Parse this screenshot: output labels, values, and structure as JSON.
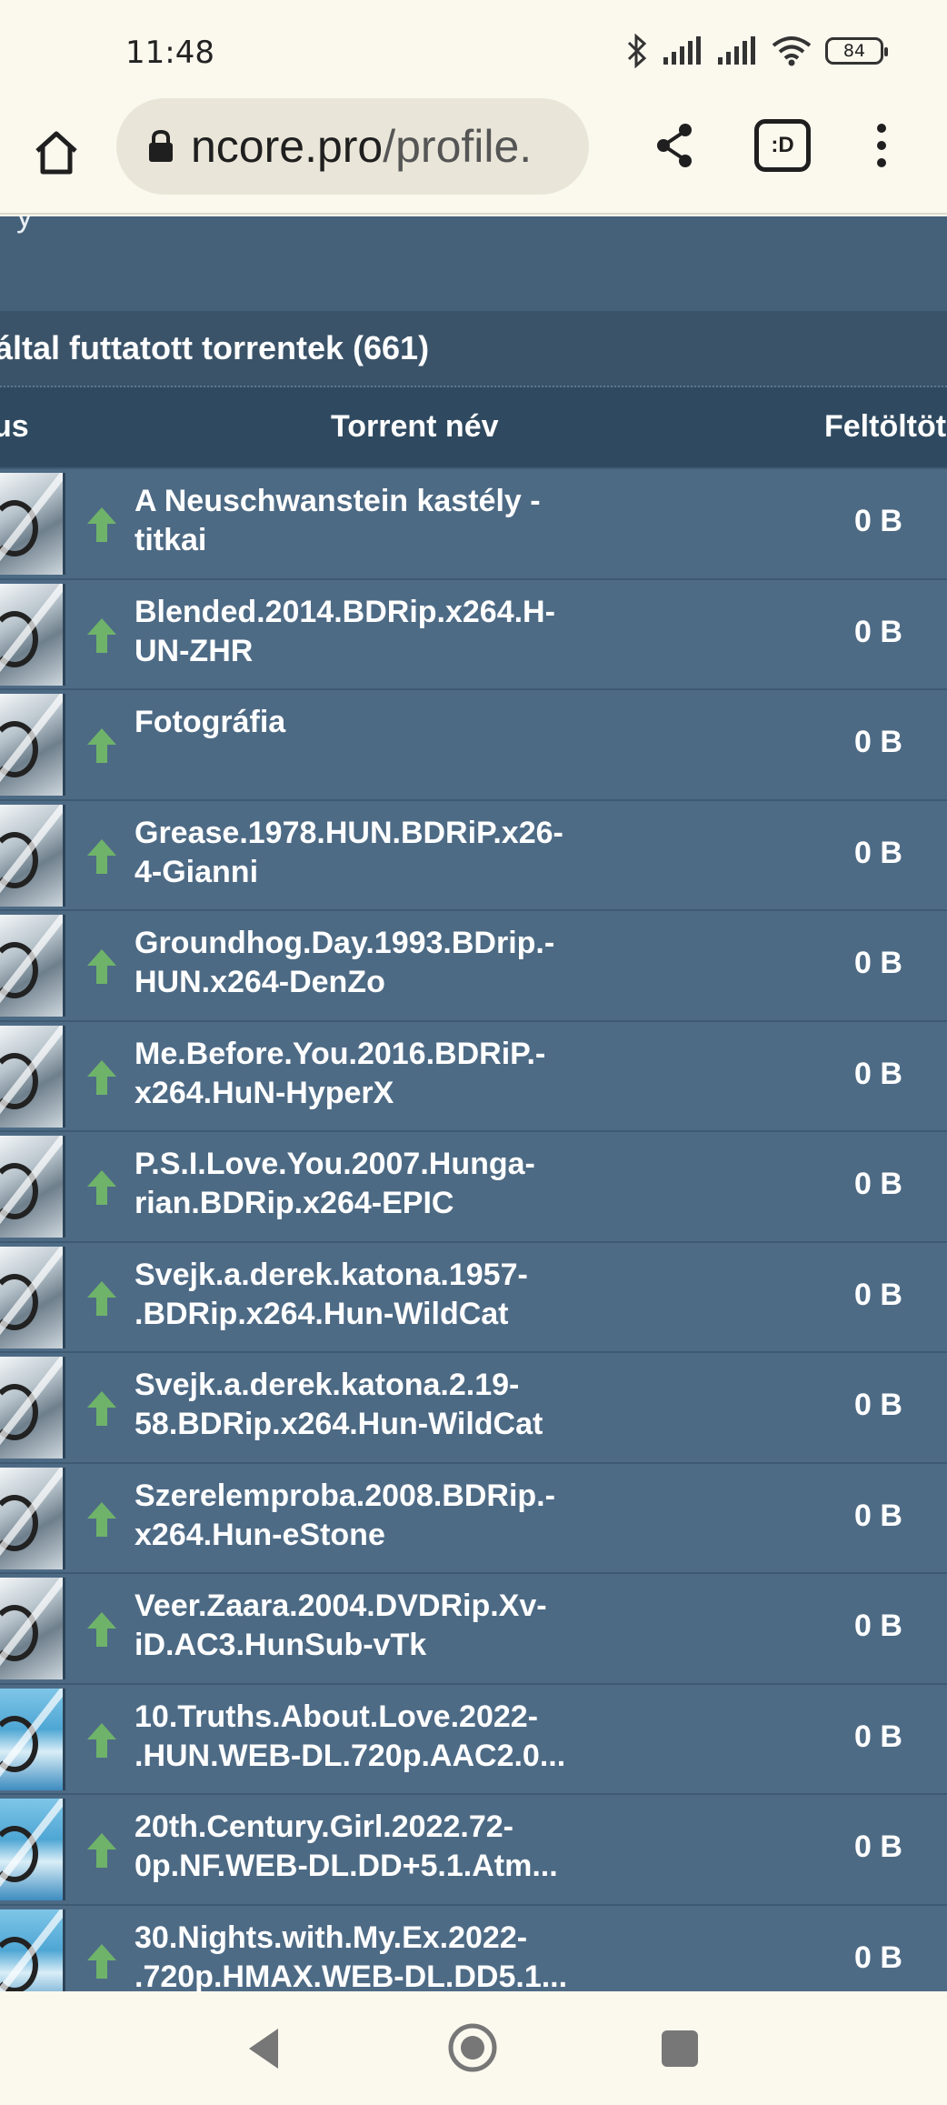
{
  "status_bar": {
    "time": "11:48",
    "battery": "84"
  },
  "browser": {
    "url_domain": "ncore.pro",
    "url_path": "/profile.",
    "tab_label": ":D"
  },
  "page": {
    "top_band_text": "y",
    "section_title": "által futtatott torrentek (661)",
    "columns": {
      "status": "us",
      "name": "Torrent név",
      "uploaded": "Feltöltöt"
    },
    "rows": [
      {
        "name": "A Neuschwanstein kastély -\ntitkai",
        "size": "0 B",
        "cat": "sd"
      },
      {
        "name": "Blended.2014.BDRip.x264.H-\nUN-ZHR",
        "size": "0 B",
        "cat": "sd"
      },
      {
        "name": "Fotográfia",
        "size": "0 B",
        "cat": "sd"
      },
      {
        "name": "Grease.1978.HUN.BDRiP.x26-\n4-Gianni",
        "size": "0 B",
        "cat": "sd"
      },
      {
        "name": "Groundhog.Day.1993.BDrip.-\nHUN.x264-DenZo",
        "size": "0 B",
        "cat": "sd"
      },
      {
        "name": "Me.Before.You.2016.BDRiP.-\nx264.HuN-HyperX",
        "size": "0 B",
        "cat": "sd"
      },
      {
        "name": "P.S.I.Love.You.2007.Hunga-\nrian.BDRip.x264-EPIC",
        "size": "0 B",
        "cat": "sd"
      },
      {
        "name": "Svejk.a.derek.katona.1957-\n.BDRip.x264.Hun-WildCat",
        "size": "0 B",
        "cat": "sd"
      },
      {
        "name": "Svejk.a.derek.katona.2.19-\n58.BDRip.x264.Hun-WildCat",
        "size": "0 B",
        "cat": "sd"
      },
      {
        "name": "Szerelemproba.2008.BDRip.-\nx264.Hun-eStone",
        "size": "0 B",
        "cat": "sd"
      },
      {
        "name": "Veer.Zaara.2004.DVDRip.Xv-\niD.AC3.HunSub-vTk",
        "size": "0 B",
        "cat": "sd"
      },
      {
        "name": "10.Truths.About.Love.2022-\n.HUN.WEB-DL.720p.AAC2.0...",
        "size": "0 B",
        "cat": "web"
      },
      {
        "name": "20th.Century.Girl.2022.72-\n0p.NF.WEB-DL.DD+5.1.Atm...",
        "size": "0 B",
        "cat": "web"
      },
      {
        "name": "30.Nights.with.My.Ex.2022-\n.720p.HMAX.WEB-DL.DD5.1...",
        "size": "0 B",
        "cat": "web"
      }
    ]
  }
}
